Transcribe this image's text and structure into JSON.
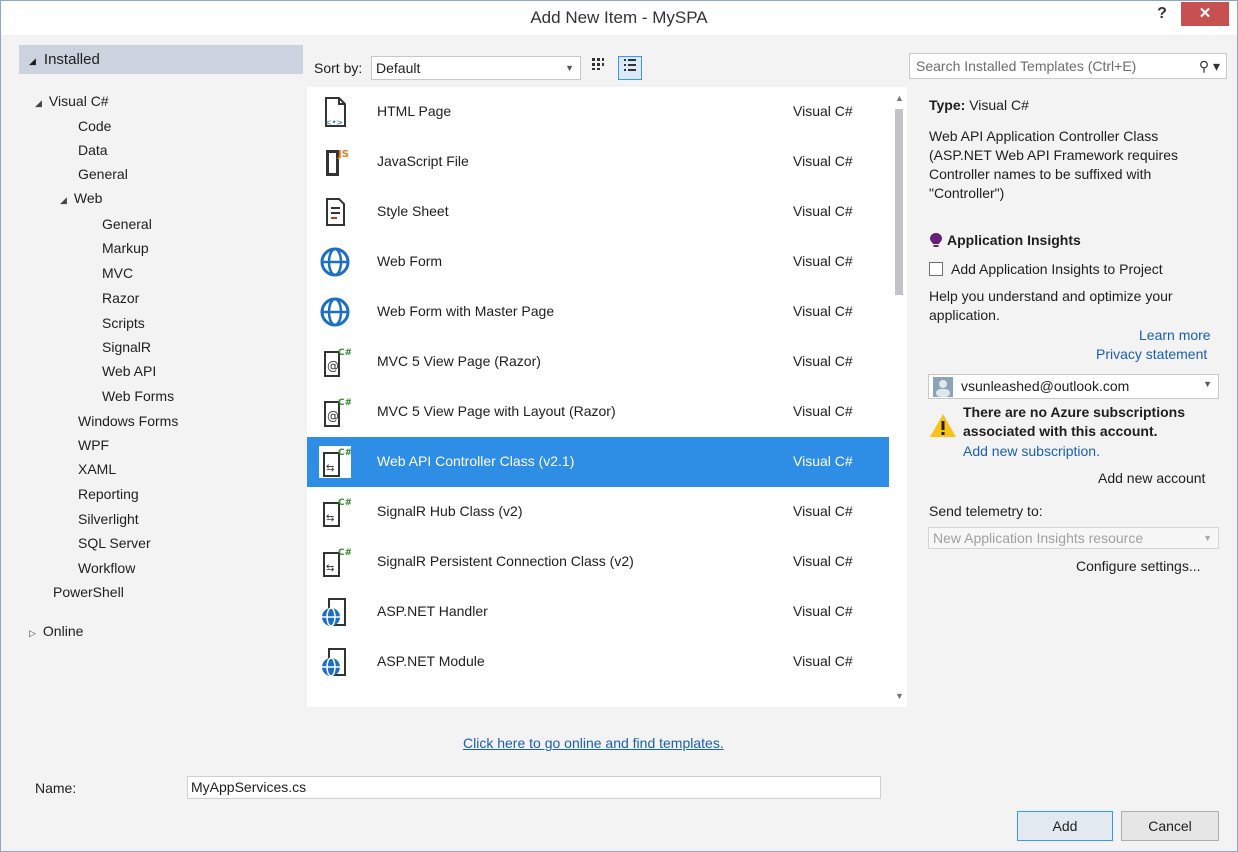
{
  "window": {
    "title": "Add New Item - MySPA",
    "help": "?",
    "close": "✕"
  },
  "tree": {
    "installed": "Installed",
    "visual_csharp": "Visual C#",
    "code": "Code",
    "data": "Data",
    "general": "General",
    "web": "Web",
    "web_children": [
      "General",
      "Markup",
      "MVC",
      "Razor",
      "Scripts",
      "SignalR",
      "Web API",
      "Web Forms"
    ],
    "after_web": [
      "Windows Forms",
      "WPF",
      "XAML",
      "Reporting",
      "Silverlight",
      "SQL Server",
      "Workflow"
    ],
    "powershell": "PowerShell",
    "online": "Online"
  },
  "toolbar": {
    "sort_label": "Sort by:",
    "sort_value": "Default"
  },
  "templates": [
    {
      "name": "HTML Page",
      "lang": "Visual C#",
      "icon": "html-page-icon"
    },
    {
      "name": "JavaScript File",
      "lang": "Visual C#",
      "icon": "javascript-file-icon"
    },
    {
      "name": "Style Sheet",
      "lang": "Visual C#",
      "icon": "style-sheet-icon"
    },
    {
      "name": "Web Form",
      "lang": "Visual C#",
      "icon": "globe-icon"
    },
    {
      "name": "Web Form with Master Page",
      "lang": "Visual C#",
      "icon": "globe-icon"
    },
    {
      "name": "MVC 5 View Page (Razor)",
      "lang": "Visual C#",
      "icon": "razor-page-icon"
    },
    {
      "name": "MVC 5 View Page with Layout (Razor)",
      "lang": "Visual C#",
      "icon": "razor-page-icon"
    },
    {
      "name": "Web API Controller Class (v2.1)",
      "lang": "Visual C#",
      "icon": "csharp-class-icon",
      "selected": true
    },
    {
      "name": "SignalR Hub Class (v2)",
      "lang": "Visual C#",
      "icon": "csharp-class-icon"
    },
    {
      "name": "SignalR Persistent Connection Class (v2)",
      "lang": "Visual C#",
      "icon": "csharp-class-icon"
    },
    {
      "name": "ASP.NET Handler",
      "lang": "Visual C#",
      "icon": "aspnet-file-icon"
    },
    {
      "name": "ASP.NET Module",
      "lang": "Visual C#",
      "icon": "aspnet-file-icon"
    }
  ],
  "online_link": "Click here to go online and find templates.",
  "details": {
    "search_placeholder": "Search Installed Templates (Ctrl+E)",
    "type_label": "Type:",
    "type_value": "Visual C#",
    "description": [
      "Web API Application Controller Class",
      "(ASP.NET Web API Framework requires",
      "Controller names to be suffixed with",
      "\"Controller\")"
    ],
    "insights_title": "Application Insights",
    "insights_checkbox": "Add Application Insights to Project",
    "insights_help": [
      "Help you understand and optimize your",
      "application."
    ],
    "learn_more": "Learn more",
    "privacy": "Privacy statement",
    "account": "vsunleashed@outlook.com",
    "warning": [
      "There are no Azure subscriptions",
      "associated with this account."
    ],
    "add_subscription": "Add new subscription.",
    "add_account": "Add new account",
    "telemetry_label": "Send telemetry to:",
    "telemetry_value": "New Application Insights resource",
    "configure": "Configure settings..."
  },
  "footer": {
    "name_label": "Name:",
    "name_value": "MyAppServices.cs",
    "add": "Add",
    "cancel": "Cancel"
  },
  "colors": {
    "selection": "#2e8de4",
    "tree_header": "#ccd3df",
    "close": "#c75050"
  }
}
